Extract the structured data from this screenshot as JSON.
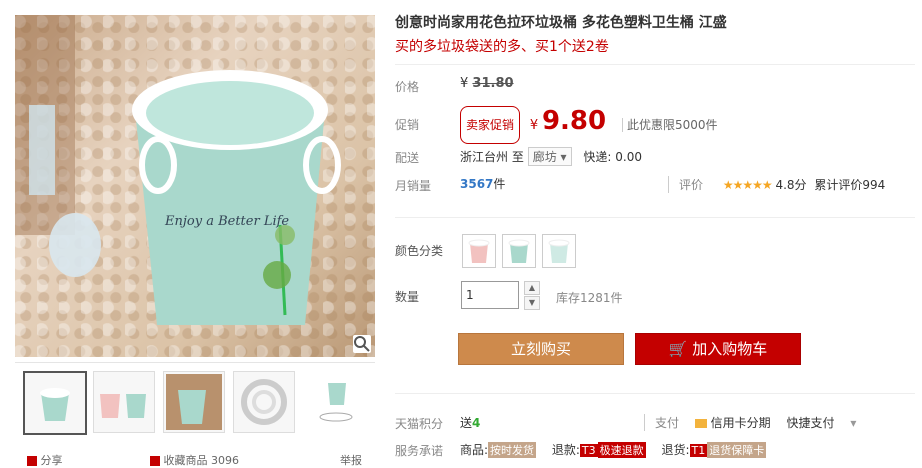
{
  "product": {
    "title": "创意时尚家用花色拉环垃圾桶 多花色塑料卫生桶 江盛",
    "subtitle": "买的多垃圾袋送的多、买1个送2卷"
  },
  "price": {
    "label": "价格",
    "currency": "¥",
    "original": "31.80"
  },
  "promo": {
    "label": "促销",
    "tag": "卖家促销",
    "currency": "¥",
    "price": "9.80",
    "limit": "此优惠限5000件"
  },
  "shipping": {
    "label": "配送",
    "from": "浙江台州",
    "to_word": "至",
    "dest": "廊坊",
    "fee": "快递: 0.00"
  },
  "sales": {
    "label": "月销量",
    "count": "3567",
    "unit": "件",
    "rating_label": "评价",
    "stars": "★★★★★",
    "score": "4.8分",
    "total_reviews": "累计评价994"
  },
  "options": {
    "color_label": "颜色分类",
    "qty_label": "数量",
    "qty_value": "1",
    "stock": "库存1281件"
  },
  "actions": {
    "buy": "立刻购买",
    "cart": "加入购物车"
  },
  "points": {
    "label": "天猫积分",
    "text_prefix": "送",
    "value": "4",
    "pay_label": "支付",
    "credit": "信用卡分期",
    "quick": "快捷支付"
  },
  "service": {
    "label": "服务承诺",
    "items": [
      {
        "prefix": "商品:",
        "badge": "按时发货"
      },
      {
        "prefix": "退款:",
        "badge_code": "T3",
        "badge": "极速退款"
      },
      {
        "prefix": "退货:",
        "badge_code": "T1",
        "badge": "退货保障卡"
      }
    ]
  },
  "gallery": {
    "bottom_share": "分享",
    "bottom_fav": "收藏商品",
    "bottom_fav_count": "3096",
    "bottom_report": "举报"
  },
  "colors": {
    "accent": "#c40000",
    "buy_btn": "#ce8a4c",
    "bucket_mint": "#a9d8cc",
    "bucket_pink": "#f2c2c0"
  }
}
